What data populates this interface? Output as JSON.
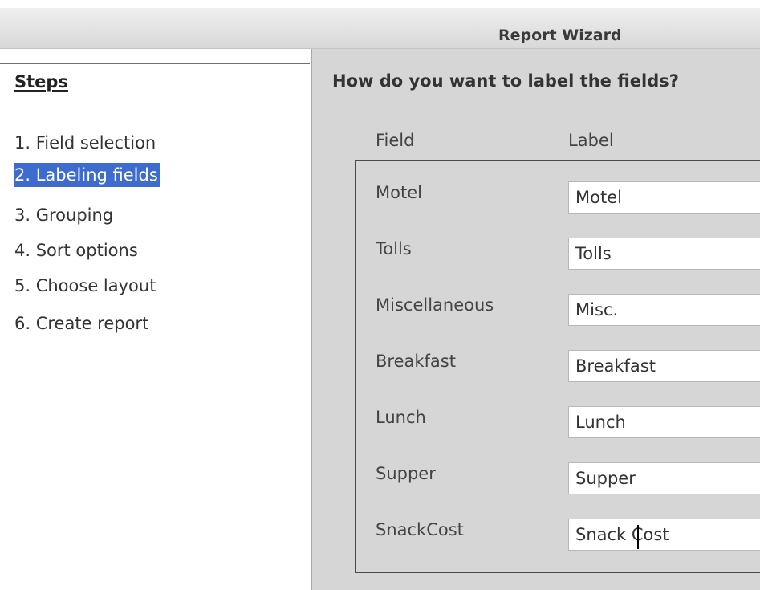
{
  "window": {
    "title": "Report Wizard"
  },
  "steps": {
    "heading": "Steps",
    "items": [
      {
        "label": "1. Field selection",
        "active": false
      },
      {
        "label": "2. Labeling fields",
        "active": true
      },
      {
        "label": "3. Grouping",
        "active": false
      },
      {
        "label": "4. Sort options",
        "active": false
      },
      {
        "label": "5. Choose layout",
        "active": false
      },
      {
        "label": "6. Create report",
        "active": false
      }
    ]
  },
  "main": {
    "question": "How do you want to label the fields?",
    "columns": {
      "field": "Field",
      "label": "Label"
    },
    "rows": [
      {
        "field": "Motel",
        "label": "Motel"
      },
      {
        "field": "Tolls",
        "label": "Tolls"
      },
      {
        "field": "Miscellaneous",
        "label": "Misc."
      },
      {
        "field": "Breakfast",
        "label": "Breakfast"
      },
      {
        "field": "Lunch",
        "label": "Lunch"
      },
      {
        "field": "Supper",
        "label": "Supper"
      },
      {
        "field": "SnackCost",
        "label": "Snack Cost"
      }
    ]
  },
  "colors": {
    "selection": "#3e6bcf",
    "panel_background": "#d6d6d6"
  }
}
